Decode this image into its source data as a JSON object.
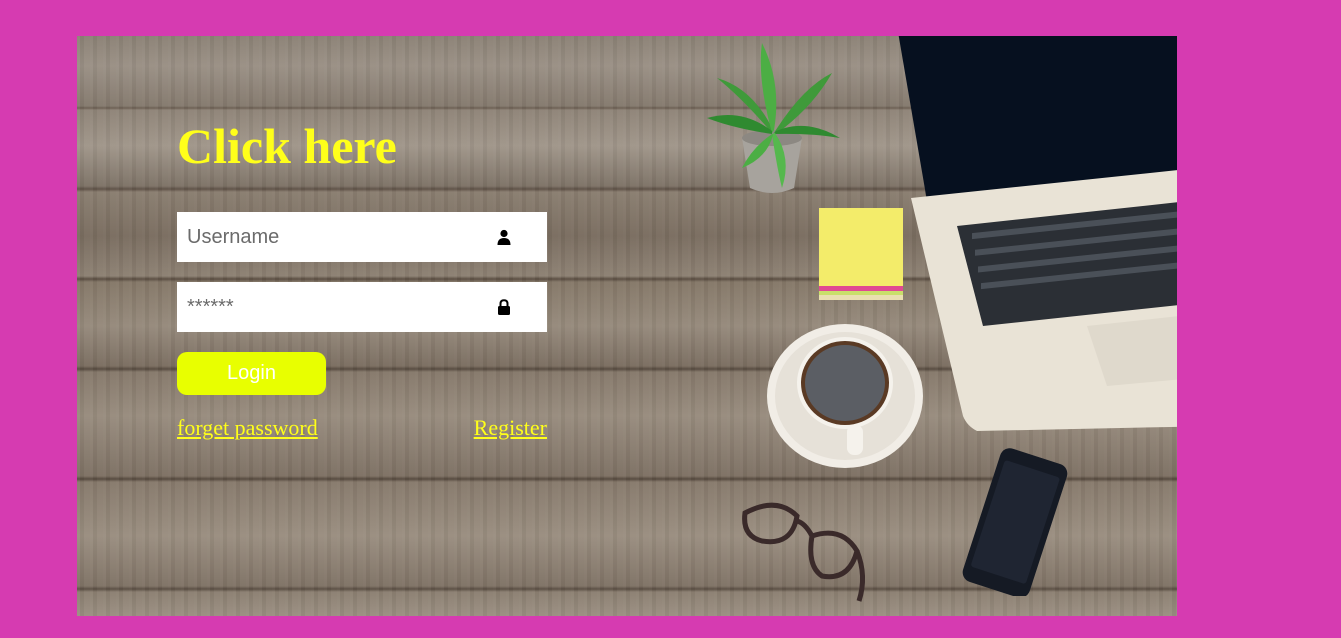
{
  "heading": "Click here",
  "username": {
    "placeholder": "Username",
    "icon": "user-icon"
  },
  "password": {
    "placeholder": "******",
    "icon": "lock-icon"
  },
  "login_label": "Login",
  "forget_password_label": "forget password",
  "register_label": "Register",
  "colors": {
    "page_background": "#d63bb1",
    "accent_text": "#ffff1a",
    "login_button": "#e8ff00"
  }
}
